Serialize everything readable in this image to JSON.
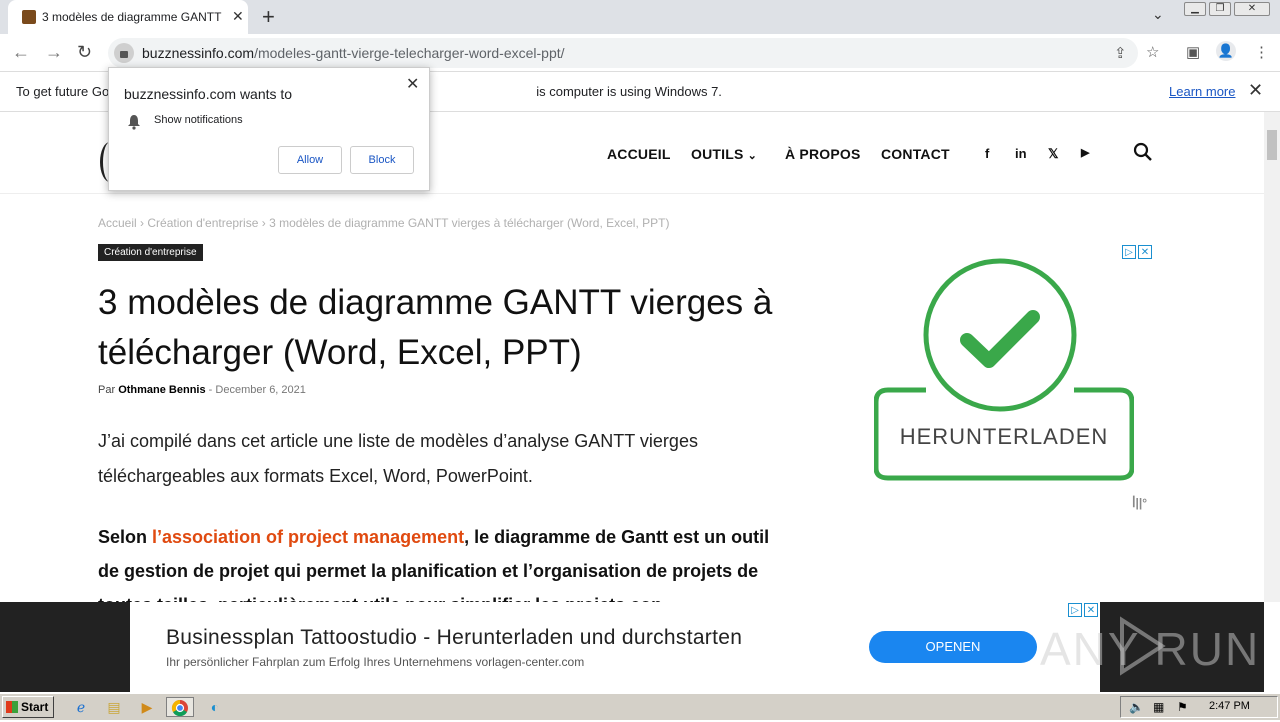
{
  "browser": {
    "tab_title": "3 modèles de diagramme GANTT vierges à télécharger (Word, Excel, PPT)",
    "url_domain": "buzznessinfo.com",
    "url_path": "/modeles-gantt-vierge-telecharger-word-excel-ppt/",
    "infobar_text_left": "To get future Go",
    "infobar_text_right": "is computer is using Windows 7.",
    "learn_more": "Learn more"
  },
  "popup": {
    "title": "buzznessinfo.com wants to",
    "permission": "Show notifications",
    "allow": "Allow",
    "block": "Block"
  },
  "nav": {
    "items": [
      "ACCUEIL",
      "OUTILS",
      "À PROPOS",
      "CONTACT"
    ],
    "social": [
      "f",
      "in",
      "𝕏",
      "▶"
    ]
  },
  "article": {
    "breadcrumb": [
      "Accueil",
      "Création d'entreprise",
      "3 modèles de diagramme GANTT vierges à télécharger (Word, Excel, PPT)"
    ],
    "category": "Création d'entreprise",
    "title": "3 modèles de diagramme GANTT vierges à télécharger (Word, Excel, PPT)",
    "by_prefix": "Par",
    "author": "Othmane Bennis",
    "date": "December 6, 2021",
    "intro": "J’ai compilé dans cet article une liste de modèles d’analyse GANTT vierges téléchargeables aux formats Excel, Word, PowerPoint.",
    "para_start": "Selon ",
    "para_link": "l’association of project management",
    "para_rest": ", le diagramme de Gantt est un outil de gestion de projet qui permet la planification et l’organisation de projets de toutes tailles, particulièrement utile pour simplifier les projets con"
  },
  "ad": {
    "button_text": "HERUNTERLADEN",
    "color": "#3aa84a"
  },
  "banner": {
    "title": "Businessplan Tattoostudio - Herunterladen und durchstarten",
    "subtitle": "Ihr persönlicher Fahrplan zum Erfolg Ihres Unternehmens vorlagen-center.com",
    "button": "OPENEN",
    "watermark": "ANY RUN"
  },
  "taskbar": {
    "start": "Start",
    "clock": "2:47 PM"
  }
}
